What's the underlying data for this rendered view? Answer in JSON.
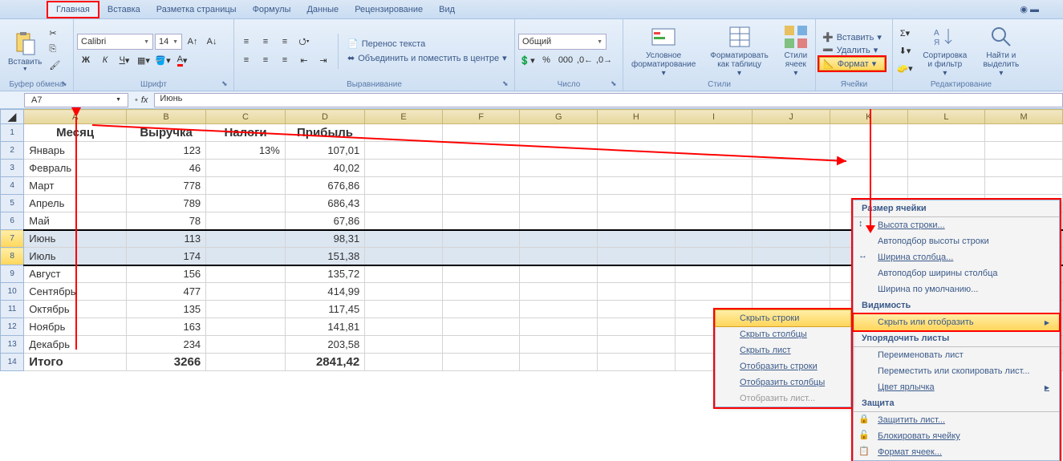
{
  "tabs": {
    "home": "Главная",
    "insert": "Вставка",
    "pageLayout": "Разметка страницы",
    "formulas": "Формулы",
    "data": "Данные",
    "review": "Рецензирование",
    "view": "Вид"
  },
  "ribbon": {
    "clipboard": {
      "paste": "Вставить",
      "group": "Буфер обмена"
    },
    "font": {
      "name": "Calibri",
      "size": "14",
      "group": "Шрифт"
    },
    "alignment": {
      "wrap": "Перенос текста",
      "merge": "Объединить и поместить в центре",
      "group": "Выравнивание"
    },
    "number": {
      "format": "Общий",
      "group": "Число"
    },
    "styles": {
      "conditional": "Условное форматирование",
      "formatTable": "Форматировать как таблицу",
      "cellStyles": "Стили ячеек",
      "group": "Стили"
    },
    "cells": {
      "insert": "Вставить",
      "delete": "Удалить",
      "format": "Формат",
      "group": "Ячейки"
    },
    "editing": {
      "sort": "Сортировка и фильтр",
      "find": "Найти и выделить",
      "group": "Редактирование"
    }
  },
  "nameBox": "A7",
  "formula": "Июнь",
  "columns": [
    "A",
    "B",
    "C",
    "D",
    "E",
    "F",
    "G",
    "H",
    "I",
    "J",
    "K",
    "L",
    "M"
  ],
  "headers": {
    "A": "Месяц",
    "B": "Выручка",
    "C": "Налоги",
    "D": "Прибыль"
  },
  "rows": [
    {
      "n": 2,
      "A": "Январь",
      "B": "123",
      "C": "13%",
      "D": "107,01"
    },
    {
      "n": 3,
      "A": "Февраль",
      "B": "46",
      "C": "",
      "D": "40,02"
    },
    {
      "n": 4,
      "A": "Март",
      "B": "778",
      "C": "",
      "D": "676,86"
    },
    {
      "n": 5,
      "A": "Апрель",
      "B": "789",
      "C": "",
      "D": "686,43"
    },
    {
      "n": 6,
      "A": "Май",
      "B": "78",
      "C": "",
      "D": "67,86"
    },
    {
      "n": 7,
      "A": "Июнь",
      "B": "113",
      "C": "",
      "D": "98,31",
      "sel": true
    },
    {
      "n": 8,
      "A": "Июль",
      "B": "174",
      "C": "",
      "D": "151,38",
      "sel": true
    },
    {
      "n": 9,
      "A": "Август",
      "B": "156",
      "C": "",
      "D": "135,72"
    },
    {
      "n": 10,
      "A": "Сентябрь",
      "B": "477",
      "C": "",
      "D": "414,99"
    },
    {
      "n": 11,
      "A": "Октябрь",
      "B": "135",
      "C": "",
      "D": "117,45"
    },
    {
      "n": 12,
      "A": "Ноябрь",
      "B": "163",
      "C": "",
      "D": "141,81"
    },
    {
      "n": 13,
      "A": "Декабрь",
      "B": "234",
      "C": "",
      "D": "203,58"
    }
  ],
  "total": {
    "n": 14,
    "A": "Итого",
    "B": "3266",
    "C": "",
    "D": "2841,42"
  },
  "formatMenu": {
    "cellSize": "Размер ячейки",
    "rowHeight": "Высота строки...",
    "autoRowHeight": "Автоподбор высоты строки",
    "colWidth": "Ширина столбца...",
    "autoColWidth": "Автоподбор ширины столбца",
    "defaultWidth": "Ширина по умолчанию...",
    "visibility": "Видимость",
    "hideShow": "Скрыть или отобразить",
    "organize": "Упорядочить листы",
    "rename": "Переименовать лист",
    "moveCopy": "Переместить или скопировать лист...",
    "tabColor": "Цвет ярлычка",
    "protection": "Защита",
    "protectSheet": "Защитить лист...",
    "lockCell": "Блокировать ячейку",
    "formatCells": "Формат ячеек..."
  },
  "hideMenu": {
    "hideRows": "Скрыть строки",
    "hideCols": "Скрыть столбцы",
    "hideSheet": "Скрыть лист",
    "showRows": "Отобразить строки",
    "showCols": "Отобразить столбцы",
    "showSheet": "Отобразить лист..."
  }
}
